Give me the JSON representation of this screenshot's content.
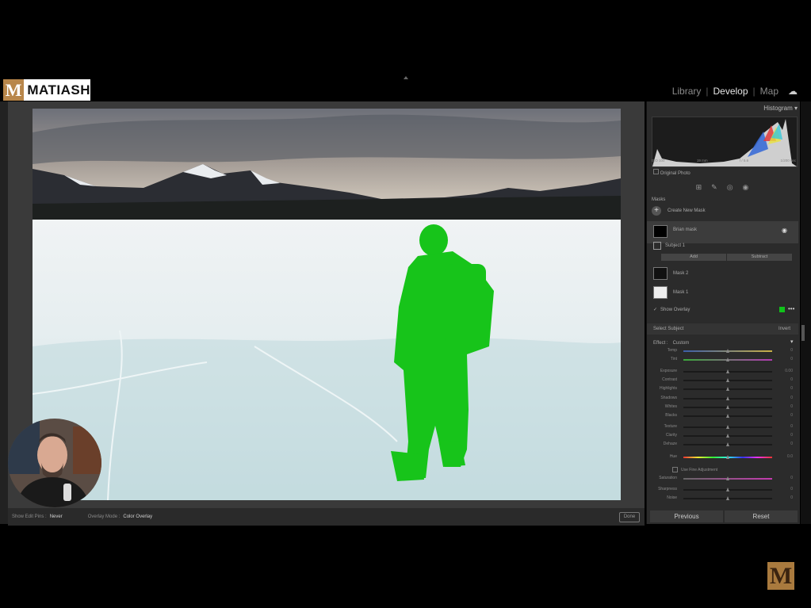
{
  "brand": {
    "logo_letter": "M",
    "logo_text": "MATIASH",
    "watermark_letter": "M"
  },
  "modules": {
    "items": [
      "Library",
      "Develop",
      "Map"
    ],
    "active": "Develop"
  },
  "panel": {
    "histogram_title": "Histogram",
    "histogram_info": [
      "ISO 100",
      "19 mm",
      "f / 5.6",
      "1/200 sec"
    ],
    "original_photo_label": "Original Photo",
    "masks_header": "Masks",
    "create_new_mask": "Create New Mask",
    "mask_brian": "Brian mask",
    "subject_label": "Subject 1",
    "add_label": "Add",
    "subtract_label": "Subtract",
    "mask2": "Mask 2",
    "mask1": "Mask 1",
    "show_overlay": "Show Overlay",
    "overlay_color": "#10c21a",
    "select_subject": "Select Subject",
    "invert_label": "Invert",
    "effect_label": "Effect :",
    "effect_value": "Custom",
    "sliders": [
      {
        "label": "Temp",
        "value": "0"
      },
      {
        "label": "Tint",
        "value": "0"
      },
      {
        "label": "Exposure",
        "value": "0.00"
      },
      {
        "label": "Contrast",
        "value": "0"
      },
      {
        "label": "Highlights",
        "value": "0"
      },
      {
        "label": "Shadows",
        "value": "0"
      },
      {
        "label": "Whites",
        "value": "0"
      },
      {
        "label": "Blacks",
        "value": "0"
      },
      {
        "label": "Texture",
        "value": "0"
      },
      {
        "label": "Clarity",
        "value": "0"
      },
      {
        "label": "Dehaze",
        "value": "0"
      },
      {
        "label": "Hue",
        "value": "0.0"
      },
      {
        "label": "Saturation",
        "value": "0"
      },
      {
        "label": "Sharpness",
        "value": "0"
      },
      {
        "label": "Noise",
        "value": "0"
      }
    ],
    "fine_adjustment": "Use Fine Adjustment",
    "previous_label": "Previous",
    "reset_label": "Reset"
  },
  "toolbar": {
    "show_edit_pins_label": "Show Edit Pins :",
    "show_edit_pins_value": "Never",
    "overlay_mode_label": "Overlay Mode :",
    "overlay_mode_value": "Color Overlay",
    "done_label": "Done"
  }
}
